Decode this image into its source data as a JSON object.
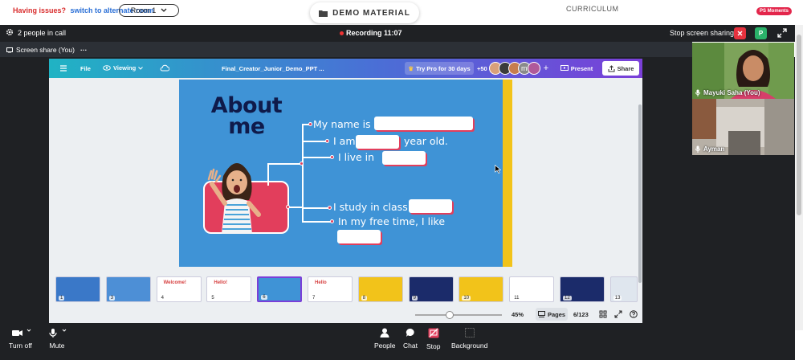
{
  "site": {
    "issues_text": "Having issues?",
    "alternate_link": "switch to alternate room",
    "room": "Room 1",
    "demo_button": "DEMO MATERIAL",
    "curriculum": "CURRICULUM",
    "moments_badge": "PS Moments"
  },
  "call": {
    "people_count": "2 people in call",
    "recording": "Recording 11:07",
    "stop_sharing": "Stop screen sharing",
    "avatar_initial": "P",
    "share_label": "Screen share (You)",
    "share_menu": "···"
  },
  "canva": {
    "file": "File",
    "viewing": "Viewing",
    "doc_title": "Final_Creator_Junior_Demo_PPT ...",
    "try_pro": "Try Pro for 30 days",
    "collab_count": "+50",
    "collab_initial": "m",
    "present": "Present",
    "share": "Share",
    "zoom": "45%",
    "pages": "Pages",
    "page_count": "6/123",
    "zoom_level": 0.4
  },
  "slide": {
    "title_line1": "About",
    "title_line2": "me",
    "line_name": "My name is",
    "line_age_a": "I am",
    "line_age_b": "year old.",
    "line_live": "I live in",
    "line_class": "I study in class",
    "line_free": "In my free time, I like"
  },
  "thumbnails": [
    {
      "num": "1",
      "color": "#3a78c8"
    },
    {
      "num": "3",
      "color": "#4d8fd6"
    },
    {
      "num": "4",
      "color": "#ffffff",
      "text": "Welcome!"
    },
    {
      "num": "5",
      "color": "#ffffff",
      "text": "Hello!"
    },
    {
      "num": "6",
      "color": "#3f93d6",
      "selected": true
    },
    {
      "num": "7",
      "color": "#ffffff",
      "text": "Hello"
    },
    {
      "num": "8",
      "color": "#f2c31a"
    },
    {
      "num": "9",
      "color": "#1b2b6a"
    },
    {
      "num": "10",
      "color": "#f2c31a"
    },
    {
      "num": "11",
      "color": "#ffffff"
    },
    {
      "num": "12",
      "color": "#1b2b6a"
    },
    {
      "num": "13",
      "color": "#dfe6ee"
    }
  ],
  "participants": [
    {
      "name": "Mayuki Saha (You)"
    },
    {
      "name": "Ayman"
    }
  ],
  "controls": {
    "camera": "Turn off",
    "mic": "Mute",
    "people": "People",
    "chat": "Chat",
    "stop": "Stop",
    "background": "Background"
  },
  "colors": {
    "accent_red": "#e23e5c",
    "slide_blue": "#3f93d6",
    "dark_bg": "#1f2124"
  }
}
